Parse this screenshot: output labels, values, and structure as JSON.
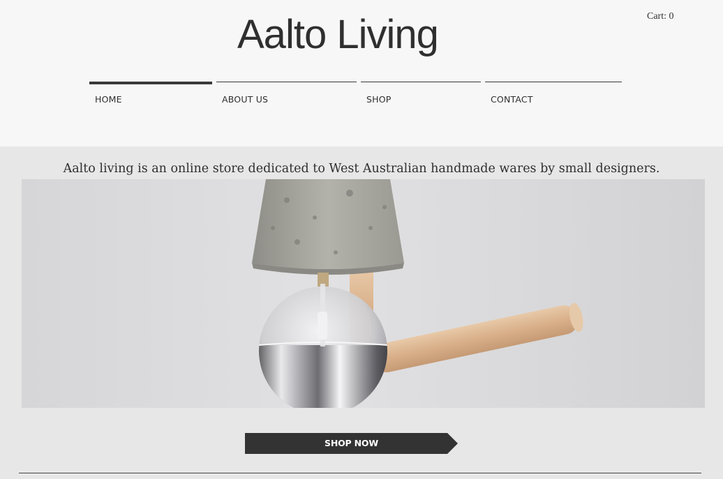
{
  "site": {
    "title": "Aalto Living",
    "cart_label": "Cart: 0"
  },
  "nav": {
    "items": [
      {
        "label": "HOME",
        "active": true
      },
      {
        "label": "ABOUT US",
        "active": false
      },
      {
        "label": "SHOP",
        "active": false
      },
      {
        "label": "CONTACT",
        "active": false
      }
    ]
  },
  "intro": {
    "tagline": "Aalto living is an online store dedicated to West Australian handmade wares by small designers."
  },
  "hero": {
    "image_subject": "concrete-pendant-lamp-photo"
  },
  "cta": {
    "label": "SHOP NOW"
  },
  "colors": {
    "header_bg": "#f7f7f7",
    "page_bg": "#e7e7e7",
    "text": "#2f2f2f",
    "button_bg": "#333333"
  }
}
